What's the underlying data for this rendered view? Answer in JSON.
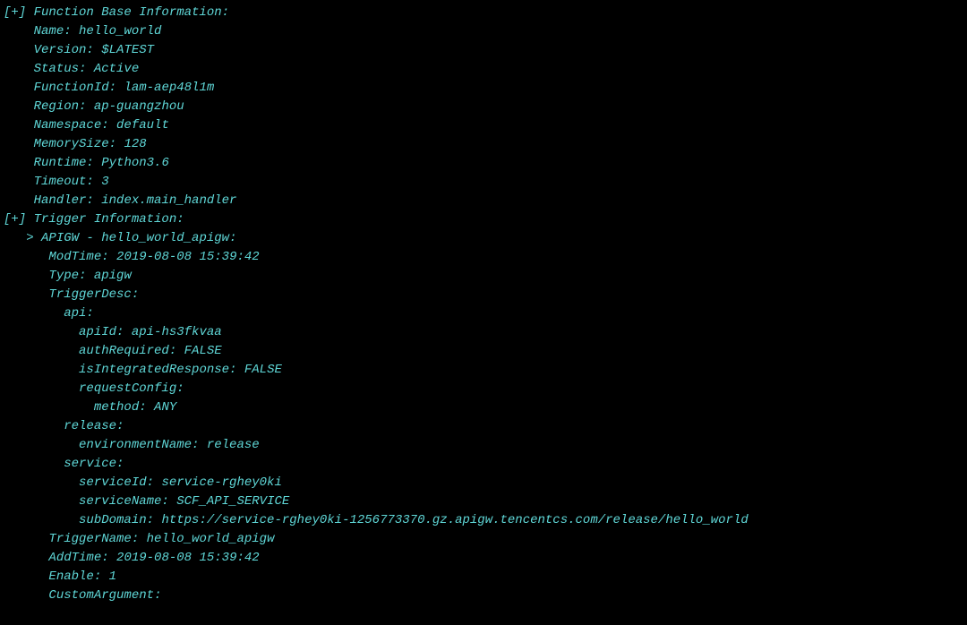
{
  "section1": {
    "header": "[+] Function Base Information:",
    "name_label": "Name:",
    "name_value": "hello_world",
    "version_label": "Version:",
    "version_value": "$LATEST",
    "status_label": "Status:",
    "status_value": "Active",
    "functionid_label": "FunctionId:",
    "functionid_value": "lam-aep48l1m",
    "region_label": "Region:",
    "region_value": "ap-guangzhou",
    "namespace_label": "Namespace:",
    "namespace_value": "default",
    "memorysize_label": "MemorySize:",
    "memorysize_value": "128",
    "runtime_label": "Runtime:",
    "runtime_value": "Python3.6",
    "timeout_label": "Timeout:",
    "timeout_value": "3",
    "handler_label": "Handler:",
    "handler_value": "index.main_handler"
  },
  "section2": {
    "header": "[+] Trigger Information:",
    "trigger_name_line": "> APIGW - hello_world_apigw:",
    "modtime_label": "ModTime:",
    "modtime_value": "2019-08-08 15:39:42",
    "type_label": "Type:",
    "type_value": "apigw",
    "triggerdesc_label": "TriggerDesc:",
    "api_label": "api:",
    "apiid_label": "apiId:",
    "apiid_value": "api-hs3fkvaa",
    "authrequired_label": "authRequired:",
    "authrequired_value": "FALSE",
    "isintegrated_label": "isIntegratedResponse:",
    "isintegrated_value": "FALSE",
    "requestconfig_label": "requestConfig:",
    "method_label": "method:",
    "method_value": "ANY",
    "release_label": "release:",
    "environmentname_label": "environmentName:",
    "environmentname_value": "release",
    "service_label": "service:",
    "serviceid_label": "serviceId:",
    "serviceid_value": "service-rghey0ki",
    "servicename_label": "serviceName:",
    "servicename_value": "SCF_API_SERVICE",
    "subdomain_label": "subDomain:",
    "subdomain_value": "https://service-rghey0ki-1256773370.gz.apigw.tencentcs.com/release/hello_world",
    "triggername_label": "TriggerName:",
    "triggername_value": "hello_world_apigw",
    "addtime_label": "AddTime:",
    "addtime_value": "2019-08-08 15:39:42",
    "enable_label": "Enable:",
    "enable_value": "1",
    "customargument_label": "CustomArgument:"
  },
  "indent": {
    "i0": "",
    "i1": "    ",
    "i2": "   ",
    "i3": "      ",
    "i4": "        ",
    "i5": "          ",
    "i6": "            "
  }
}
